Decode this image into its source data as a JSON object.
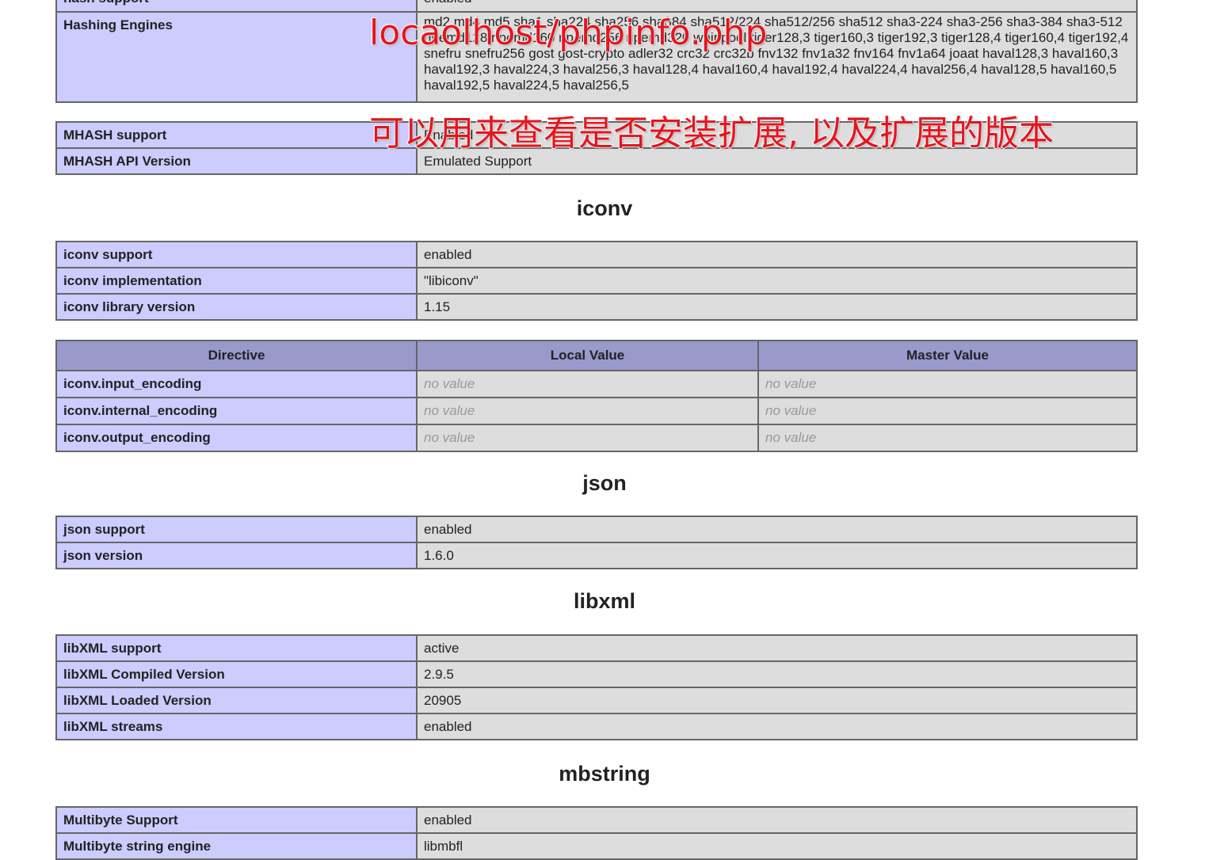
{
  "overlay": {
    "url_caption": "locaolhost/phpinfo.php",
    "note_caption": "可以用来查看是否安装扩展, 以及扩展的版本"
  },
  "hash": {
    "rows": [
      {
        "name": "hash support",
        "value": "enabled"
      },
      {
        "name": "Hashing Engines",
        "value": "md2 md4 md5 sha1 sha224 sha256 sha384 sha512/224 sha512/256 sha512 sha3-224 sha3-256 sha3-384 sha3-512 ripemd128 ripemd160 ripemd256 ripemd320 whirlpool tiger128,3 tiger160,3 tiger192,3 tiger128,4 tiger160,4 tiger192,4 snefru snefru256 gost gost-crypto adler32 crc32 crc32b fnv132 fnv1a32 fnv164 fnv1a64 joaat haval128,3 haval160,3 haval192,3 haval224,3 haval256,3 haval128,4 haval160,4 haval192,4 haval224,4 haval256,4 haval128,5 haval160,5 haval192,5 haval224,5 haval256,5"
      }
    ],
    "mhash_rows": [
      {
        "name": "MHASH support",
        "value": "Enabled"
      },
      {
        "name": "MHASH API Version",
        "value": "Emulated Support"
      }
    ]
  },
  "iconv": {
    "title": "iconv",
    "rows": [
      {
        "name": "iconv support",
        "value": "enabled"
      },
      {
        "name": "iconv implementation",
        "value": "\"libiconv\""
      },
      {
        "name": "iconv library version",
        "value": "1.15"
      }
    ],
    "directive_headers": [
      "Directive",
      "Local Value",
      "Master Value"
    ],
    "directives": [
      {
        "name": "iconv.input_encoding",
        "local": "no value",
        "master": "no value"
      },
      {
        "name": "iconv.internal_encoding",
        "local": "no value",
        "master": "no value"
      },
      {
        "name": "iconv.output_encoding",
        "local": "no value",
        "master": "no value"
      }
    ]
  },
  "json": {
    "title": "json",
    "rows": [
      {
        "name": "json support",
        "value": "enabled"
      },
      {
        "name": "json version",
        "value": "1.6.0"
      }
    ]
  },
  "libxml": {
    "title": "libxml",
    "rows": [
      {
        "name": "libXML support",
        "value": "active"
      },
      {
        "name": "libXML Compiled Version",
        "value": "2.9.5"
      },
      {
        "name": "libXML Loaded Version",
        "value": "20905"
      },
      {
        "name": "libXML streams",
        "value": "enabled"
      }
    ]
  },
  "mbstring": {
    "title": "mbstring",
    "rows": [
      {
        "name": "Multibyte Support",
        "value": "enabled"
      },
      {
        "name": "Multibyte string engine",
        "value": "libmbfl"
      }
    ]
  }
}
